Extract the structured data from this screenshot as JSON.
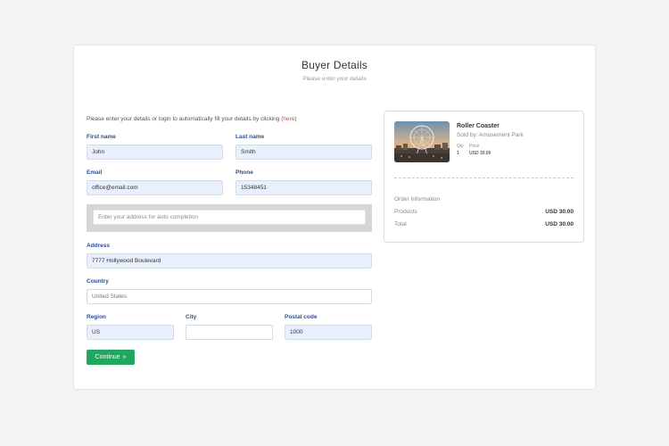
{
  "header": {
    "title": "Buyer Details",
    "subtitle": "Please enter your details"
  },
  "intro": {
    "text": "Please enter your details or login to automatically fill your details by clicking (",
    "link": "here",
    "close": ")"
  },
  "form": {
    "first_name": {
      "label": "First name",
      "value": "John"
    },
    "last_name": {
      "label": "Last name",
      "value": "Smith"
    },
    "email": {
      "label": "Email",
      "value": "office@email.com"
    },
    "phone": {
      "label": "Phone",
      "value": "15348451"
    },
    "autocomplete": {
      "placeholder": "Enter your address for auto completion"
    },
    "address": {
      "label": "Address",
      "value": "7777 Hollywood Boulevard"
    },
    "country": {
      "label": "Country",
      "value": "United States"
    },
    "region": {
      "label": "Region",
      "value": "US"
    },
    "city": {
      "label": "City",
      "value": ""
    },
    "postal_code": {
      "label": "Postal code",
      "value": "1000"
    },
    "continue_label": "Continue",
    "continue_icon": "double-chevron-right-icon"
  },
  "summary": {
    "product_name": "Roller Coaster",
    "seller": "Sold by: Amusement Park",
    "qty_label": "Qty",
    "qty_value": "1",
    "price_label": "Price",
    "price_value": "USD 30.00",
    "order_info_title": "Order Information",
    "products_label": "Products",
    "products_value": "USD 30.00",
    "total_label": "Total",
    "total_value": "USD 30.00"
  },
  "colors": {
    "accent_button": "#22a75e",
    "label_blue": "#2f4e8a",
    "link": "#d9553a",
    "field_fill": "#e8f0fe"
  }
}
